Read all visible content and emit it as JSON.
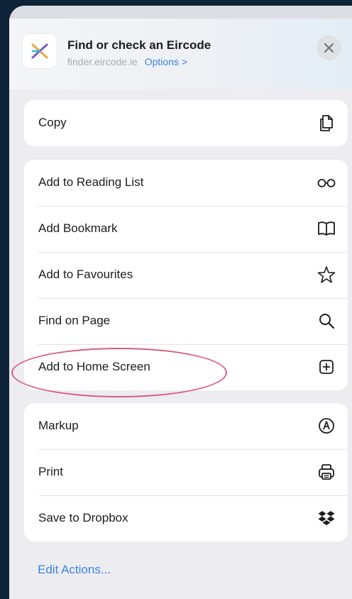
{
  "header": {
    "title": "Find or check an Eircode",
    "domain": "finder.eircode.ie",
    "options_label": "Options >"
  },
  "groups": [
    {
      "items": [
        {
          "label": "Copy",
          "icon": "copy-icon"
        }
      ]
    },
    {
      "items": [
        {
          "label": "Add to Reading List",
          "icon": "glasses-icon"
        },
        {
          "label": "Add Bookmark",
          "icon": "book-icon"
        },
        {
          "label": "Add to Favourites",
          "icon": "star-icon"
        },
        {
          "label": "Find on Page",
          "icon": "magnifier-icon"
        },
        {
          "label": "Add to Home Screen",
          "icon": "plus-square-icon"
        }
      ]
    },
    {
      "items": [
        {
          "label": "Markup",
          "icon": "markup-pen-icon"
        },
        {
          "label": "Print",
          "icon": "printer-icon"
        },
        {
          "label": "Save to Dropbox",
          "icon": "dropbox-icon"
        }
      ]
    }
  ],
  "footer": {
    "edit_actions_label": "Edit Actions..."
  },
  "colors": {
    "accent": "#3b84e0",
    "highlight_ring": "#d95c7d",
    "sheet_background": "#ececf1"
  }
}
